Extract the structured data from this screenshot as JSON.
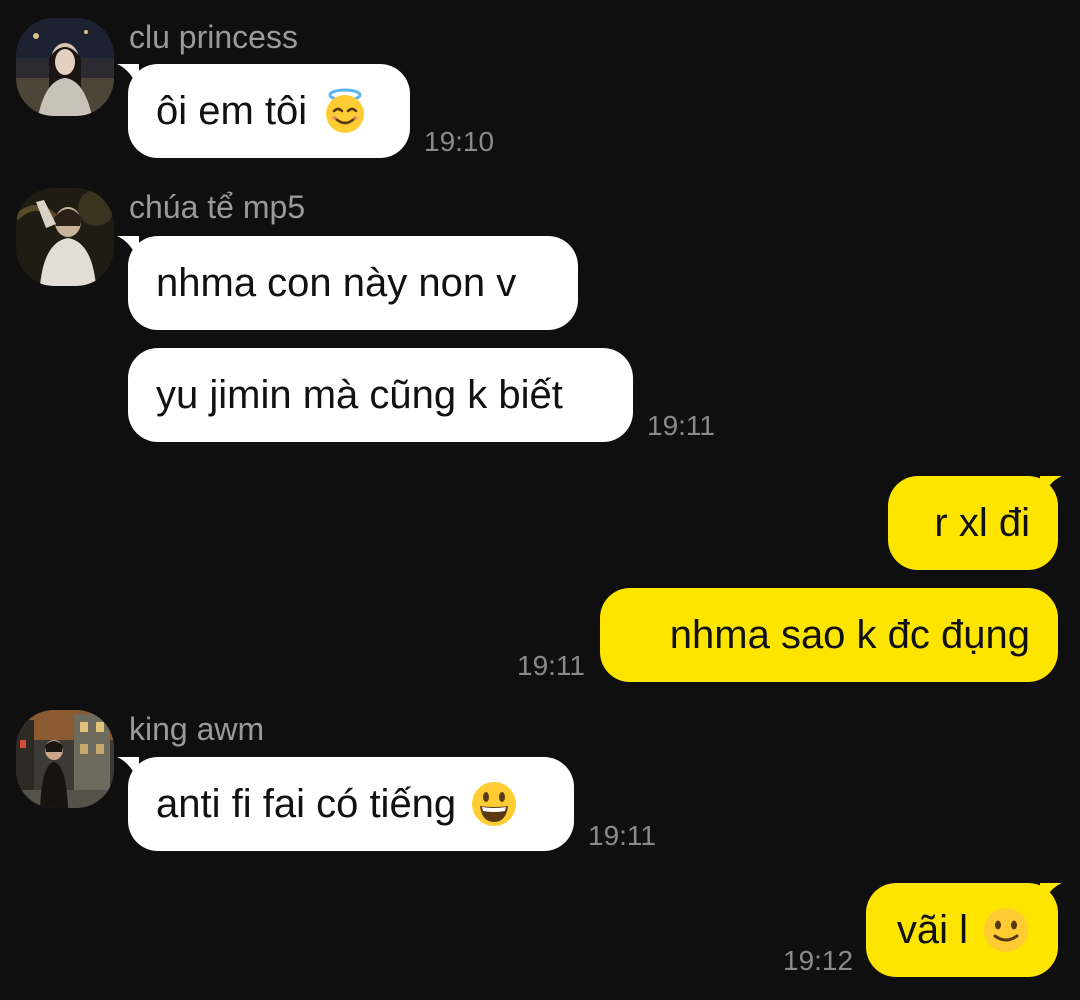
{
  "messages": [
    {
      "sender": "clu princess",
      "text": "ôi em tôi",
      "emoji": "smiling-halo-emoji",
      "time": "19:10"
    },
    {
      "sender": "chúa tể mp5",
      "text": "nhma con này non v"
    },
    {
      "text": "yu jimin mà cũng k biết",
      "time": "19:11"
    },
    {
      "text": "r xl đi"
    },
    {
      "text": "nhma sao k đc đụng",
      "time": "19:11"
    },
    {
      "sender": "king awm",
      "text": "anti fi fai có tiếng",
      "emoji": "grinning-face-emoji",
      "time": "19:11"
    },
    {
      "text": "vãi l",
      "emoji": "slightly-smiling-face-emoji",
      "time": "19:12"
    }
  ],
  "colors": {
    "background": "#0f0f0f",
    "incoming_bubble": "#ffffff",
    "outgoing_bubble": "#fee500",
    "sender_name": "#9a9a9a",
    "timestamp": "#8a8a8a"
  }
}
